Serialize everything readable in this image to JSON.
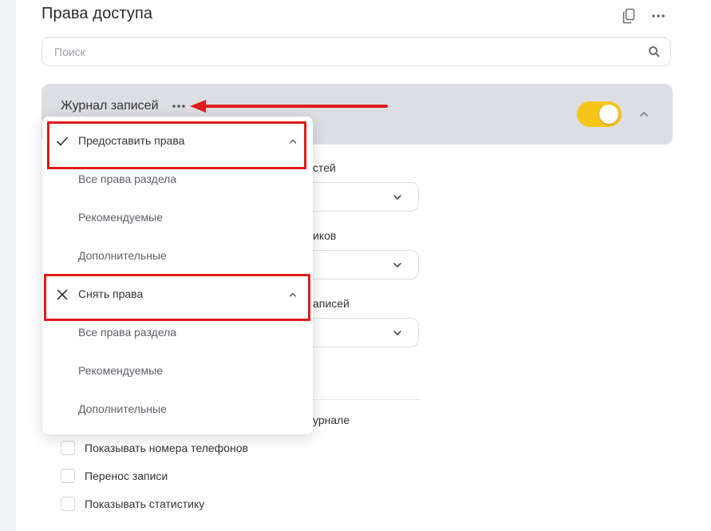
{
  "page": {
    "title": "Права доступа"
  },
  "toolbar": {
    "copy_icon": "copy-icon",
    "more_icon": "more-horizontal-icon"
  },
  "search": {
    "placeholder": "Поиск",
    "value": "",
    "icon": "search-icon"
  },
  "section": {
    "title": "Журнал записей",
    "menu_icon": "more-horizontal-icon",
    "toggle_on": true,
    "toggle_color": "#f5c518",
    "chevron_icon": "chevron-up-icon"
  },
  "background_fields": {
    "field1_label_tail": "стей",
    "field2_label_tail": "иков",
    "field3_label_tail": "аписей",
    "field4_label_tail": "урнале"
  },
  "checkboxes": [
    {
      "label": "Показывать номера телефонов",
      "checked": false
    },
    {
      "label": "Перенос записи",
      "checked": false
    },
    {
      "label": "Показывать статистику",
      "checked": false
    }
  ],
  "dropdown": {
    "groups": [
      {
        "label": "Предоставить права",
        "icon": "check-icon",
        "expanded": true,
        "items": [
          "Все права раздела",
          "Рекомендуемые",
          "Дополнительные"
        ]
      },
      {
        "label": "Снять права",
        "icon": "close-icon",
        "expanded": true,
        "items": [
          "Все права раздела",
          "Рекомендуемые",
          "Дополнительные"
        ]
      }
    ]
  },
  "annotation": {
    "color": "#e01b1b"
  }
}
